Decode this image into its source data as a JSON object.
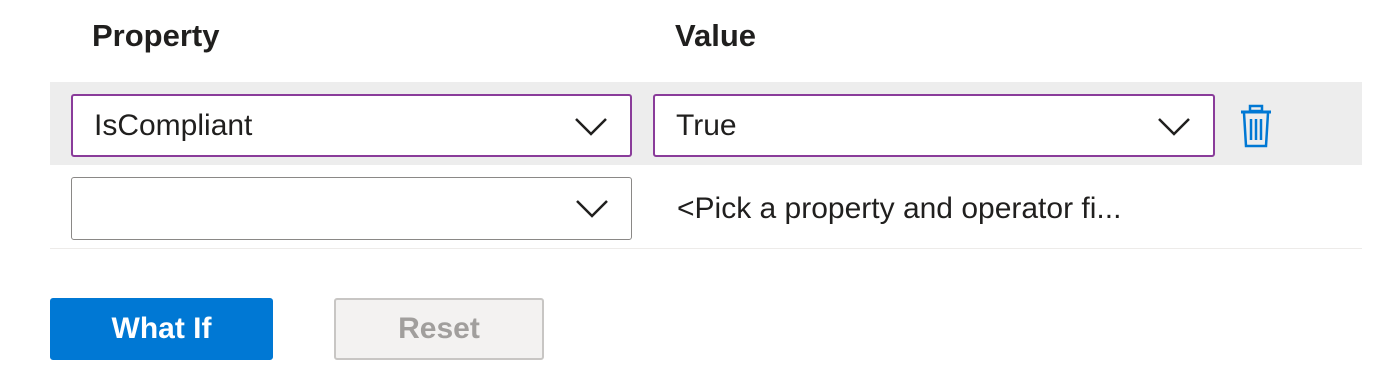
{
  "headers": {
    "property": "Property",
    "value": "Value"
  },
  "rows": [
    {
      "property": "IsCompliant",
      "value": "True"
    },
    {
      "property": "",
      "value_placeholder": "<Pick a property and operator fi..."
    }
  ],
  "buttons": {
    "what_if": "What If",
    "reset": "Reset"
  },
  "colors": {
    "accent": "#0078d4",
    "focus_border": "#8a3c9a",
    "selected_row": "#ededed"
  },
  "icons": {
    "dropdown": "chevron-down-icon",
    "delete": "trash-icon"
  }
}
